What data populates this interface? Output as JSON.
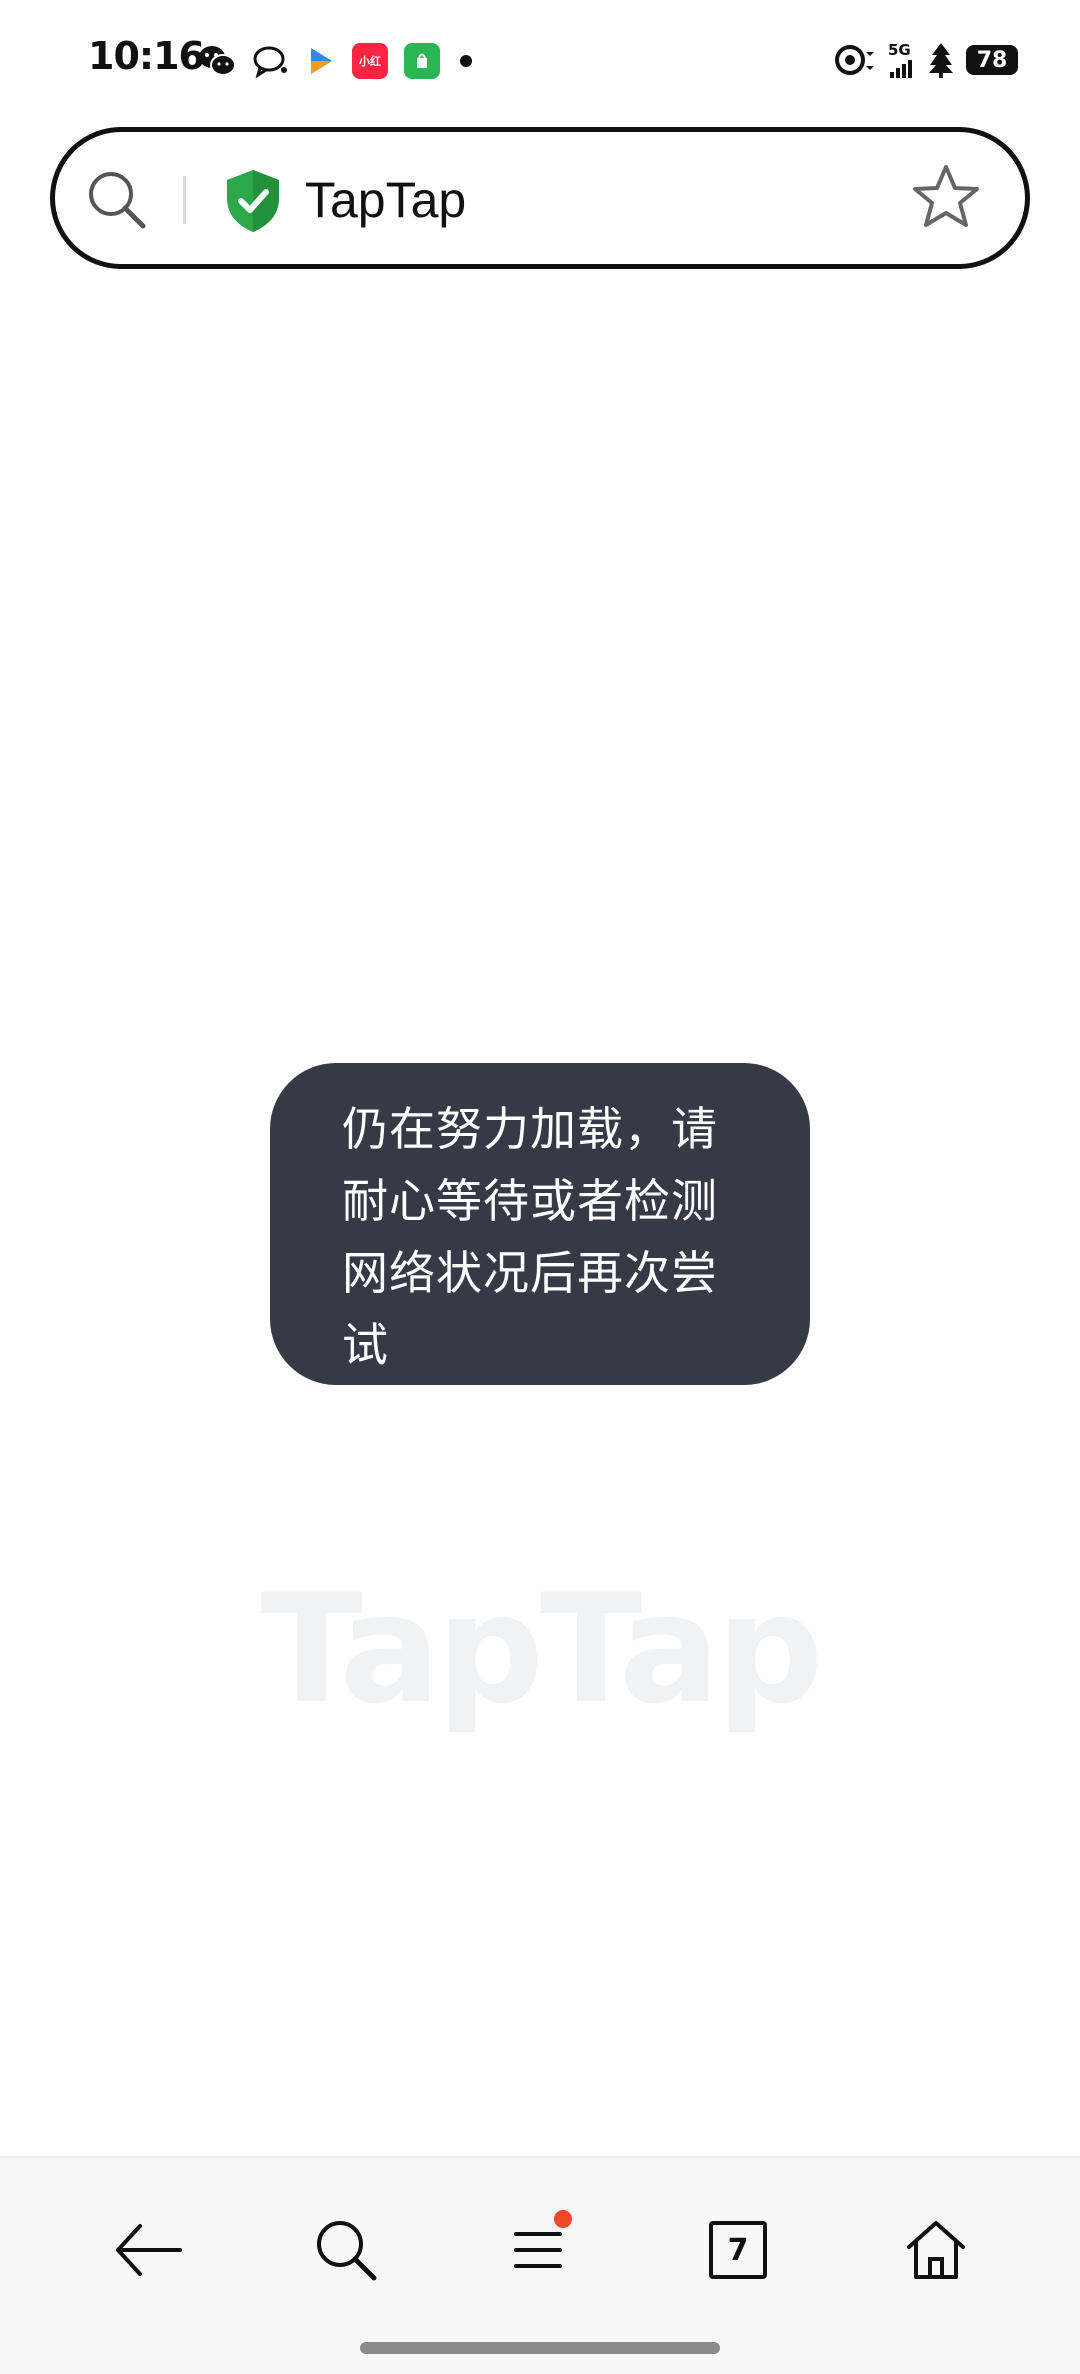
{
  "status_bar": {
    "time": "10:16",
    "network": "5G",
    "battery": "78",
    "left_icons": [
      "wechat-icon",
      "chat-bubble-icon",
      "play-icon",
      "xiaohongshu-icon",
      "shop-bag-icon",
      "dot-icon"
    ],
    "right_icons": [
      "target-icon",
      "signal-icon",
      "tree-icon",
      "battery-icon"
    ]
  },
  "address_bar": {
    "text": "TapTap",
    "icons": [
      "search-icon",
      "shield-check-icon",
      "star-icon"
    ]
  },
  "content": {
    "watermark": "TapTap"
  },
  "toast": {
    "message": "仍在努力加载，请耐心等待或者检测网络状况后再次尝试"
  },
  "bottom_nav": {
    "tab_count": "7",
    "items": [
      "back-arrow-icon",
      "search-icon",
      "menu-icon",
      "tabs-icon",
      "home-icon"
    ]
  },
  "colors": {
    "toast_bg": "#363a47",
    "shield_green": "#2aa84a",
    "notification_dot": "#f3472a",
    "xiaohongshu_red": "#ff2442",
    "shop_green": "#2bb553"
  }
}
